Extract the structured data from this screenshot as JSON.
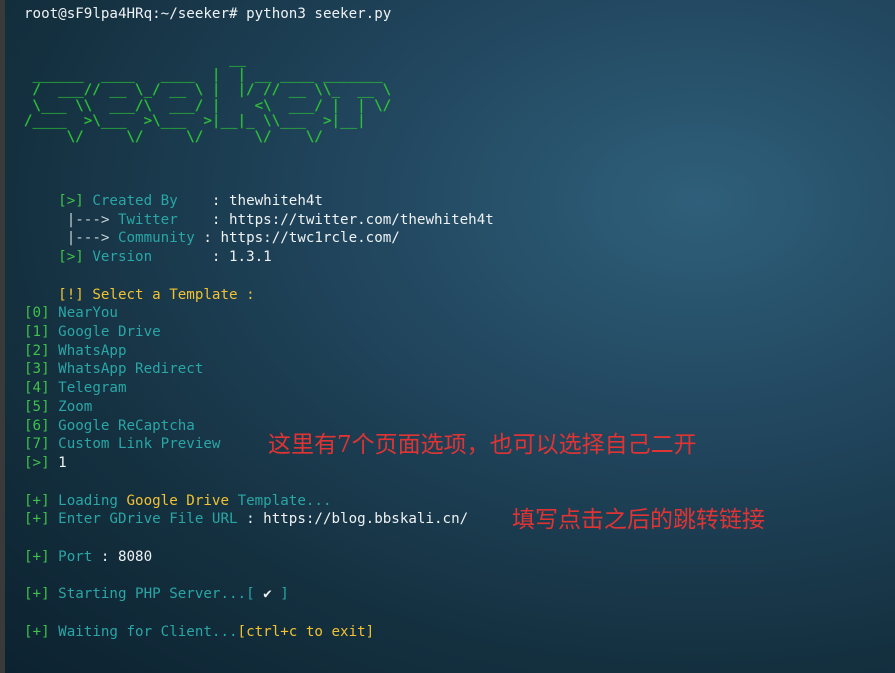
{
  "prompt": "root@sF9lpa4HRq:~/seeker# python3 seeker.py",
  "banner_ascii": "                        __\n ______  ____   ____  |  | __ ____ _______\n /  ___// __ \\_/ __ \\ |  |/ // __ \\\\_  __ \\\n \\___ \\\\  ___/\\  ___/ |    <\\  ___/ |  | \\/\n/____  >\\___  >\\___  >|__|_ \\\\___  >|__|\n     \\/     \\/     \\/      \\/    \\/",
  "info": {
    "created_by_prefix": "[>]",
    "created_by_label": "Created By",
    "created_by_value": "thewhiteh4t",
    "twitter_prefix": " |--->",
    "twitter_label": "Twitter",
    "twitter_value": "https://twitter.com/thewhiteh4t",
    "community_prefix": " |--->",
    "community_label": "Community",
    "community_value": "https://twc1rcle.com/",
    "version_prefix": "[>]",
    "version_label": "Version",
    "version_value": "1.3.1",
    "sep": " : "
  },
  "select": {
    "prefix": "[!]",
    "label": "Select a Template :"
  },
  "templates": [
    {
      "index": "[0]",
      "name": "NearYou"
    },
    {
      "index": "[1]",
      "name": "Google Drive"
    },
    {
      "index": "[2]",
      "name": "WhatsApp"
    },
    {
      "index": "[3]",
      "name": "WhatsApp Redirect"
    },
    {
      "index": "[4]",
      "name": "Telegram"
    },
    {
      "index": "[5]",
      "name": "Zoom"
    },
    {
      "index": "[6]",
      "name": "Google ReCaptcha"
    },
    {
      "index": "[7]",
      "name": "Custom Link Preview"
    }
  ],
  "choice": {
    "prefix": "[>]",
    "value": "1"
  },
  "loading": {
    "prefix": "[+]",
    "text1": "Loading",
    "highlight": "Google Drive",
    "text2": "Template..."
  },
  "enter_url": {
    "prefix": "[+]",
    "label": "Enter GDrive File URL",
    "sep": " : ",
    "value": "https://blog.bbskali.cn/"
  },
  "port": {
    "prefix": "[+]",
    "label": "Port",
    "sep": " : ",
    "value": "8080"
  },
  "starting": {
    "prefix": "[+]",
    "text": "Starting PHP Server...[",
    "check": "✔",
    "end": "]"
  },
  "waiting": {
    "prefix": "[+]",
    "text": "Waiting for Client...",
    "hint": "[ctrl+c to exit]"
  },
  "annotations": {
    "note1": "这里有7个页面选项，也可以选择自己二开",
    "note2": "填写点击之后的跳转链接"
  }
}
